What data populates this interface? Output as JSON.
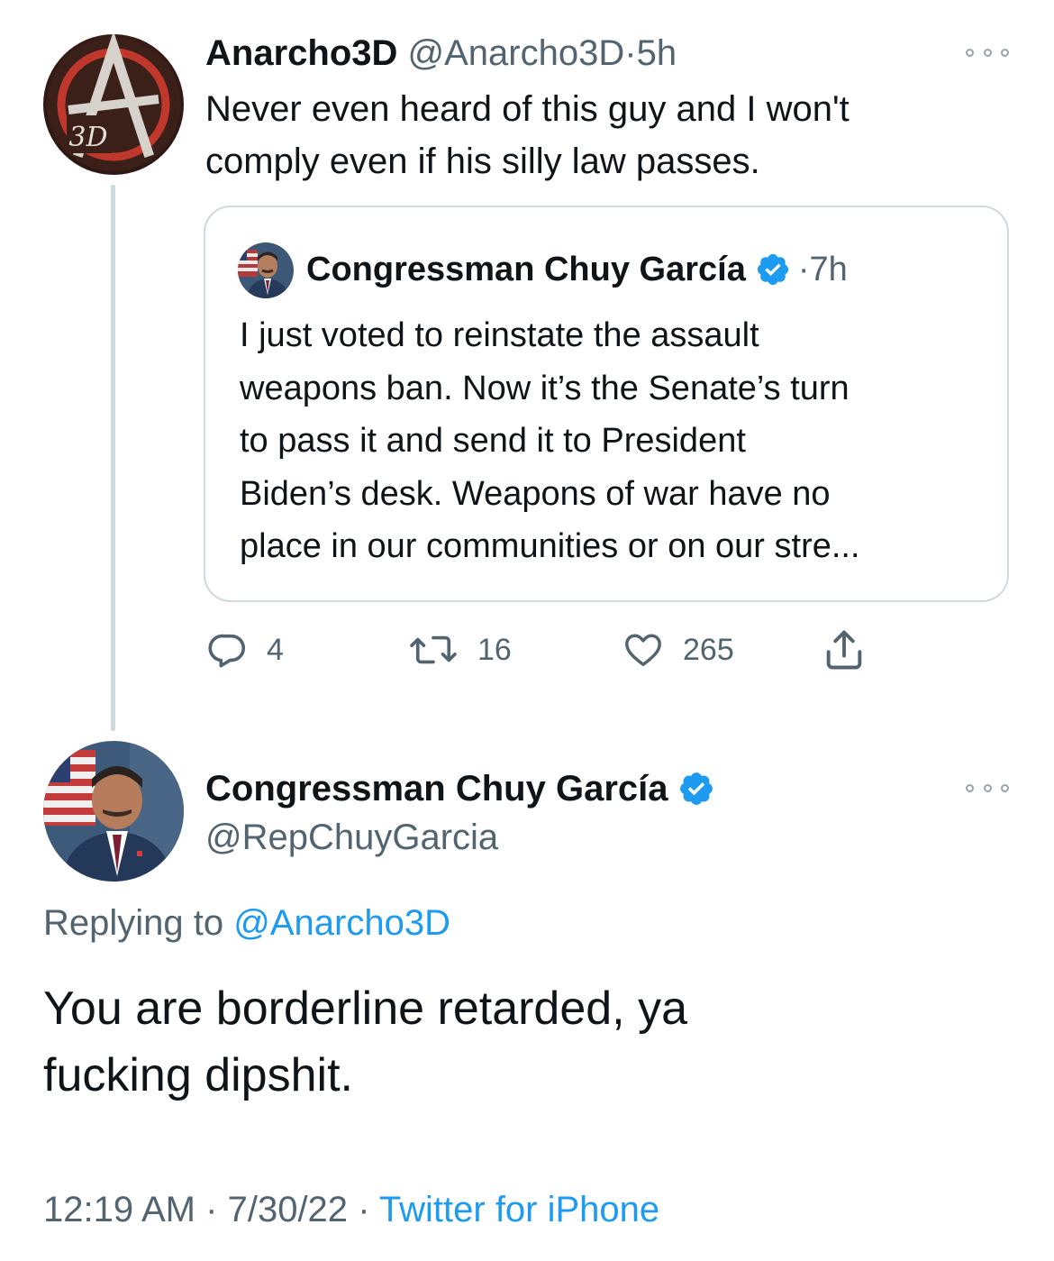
{
  "tweet1": {
    "avatar_label": "3D",
    "display_name": "Anarcho3D",
    "handle": "@Anarcho3D",
    "separator": "·",
    "time": "5h",
    "text_line1": "Never even heard of this guy and I won't",
    "text_line2": "comply even if his silly law passes."
  },
  "quoted": {
    "display_name": "Congressman Chuy García",
    "separator": "·",
    "time": "7h",
    "lines": [
      "I just voted to reinstate the assault",
      "weapons ban. Now it’s the Senate’s turn",
      "to pass it and send it to President",
      "Biden’s desk. Weapons of war have no",
      "place in our communities or on our stre..."
    ]
  },
  "actions": {
    "replies": "4",
    "retweets": "16",
    "likes": "265"
  },
  "tweet2": {
    "display_name": "Congressman Chuy García",
    "handle": "@RepChuyGarcia",
    "replying_prefix": "Replying to",
    "replying_handle": "@Anarcho3D",
    "text_line1": "You are borderline retarded, ya",
    "text_line2": "fucking dipshit.",
    "time": "12:19 AM",
    "separator": "·",
    "date": "7/30/22",
    "source": "Twitter for iPhone"
  },
  "colors": {
    "text": "#0f1419",
    "muted": "#536471",
    "link": "#1d9bf0",
    "border": "#cfd9de",
    "verified": "#1d9bf0"
  },
  "icons": [
    "reply-icon",
    "retweet-icon",
    "like-icon",
    "share-icon",
    "verified-badge-icon",
    "more-icon"
  ]
}
